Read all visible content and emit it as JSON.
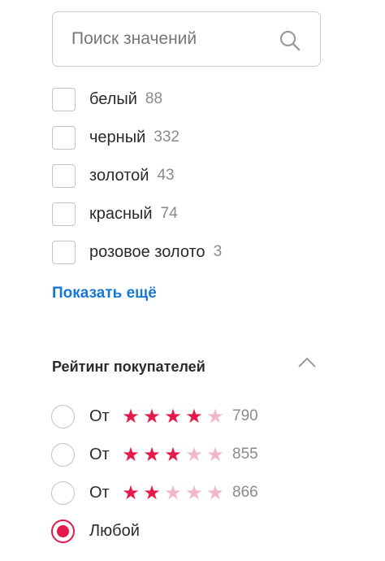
{
  "search": {
    "placeholder": "Поиск значений",
    "icon": "search-icon"
  },
  "colors": {
    "filters": [
      {
        "label": "белый",
        "count": "88",
        "checked": false
      },
      {
        "label": "черный",
        "count": "332",
        "checked": false
      },
      {
        "label": "золотой",
        "count": "43",
        "checked": false
      },
      {
        "label": "красный",
        "count": "74",
        "checked": false
      },
      {
        "label": "розовое золото",
        "count": "3",
        "checked": false
      }
    ],
    "show_more": "Показать ещё"
  },
  "rating": {
    "title": "Рейтинг покупателей",
    "collapse_icon": "chevron-up-icon",
    "options": [
      {
        "label": "От",
        "stars_filled": 4,
        "stars_total": 5,
        "count": "790",
        "selected": false
      },
      {
        "label": "От",
        "stars_filled": 3,
        "stars_total": 5,
        "count": "855",
        "selected": false
      },
      {
        "label": "От",
        "stars_filled": 2,
        "stars_total": 5,
        "count": "866",
        "selected": false
      },
      {
        "label": "Любой",
        "selected": true
      }
    ]
  },
  "theme": {
    "accent": "#e6194b",
    "accent_light": "#f2b8c6",
    "link": "#1678d6",
    "muted_text": "#8a8a8a"
  }
}
